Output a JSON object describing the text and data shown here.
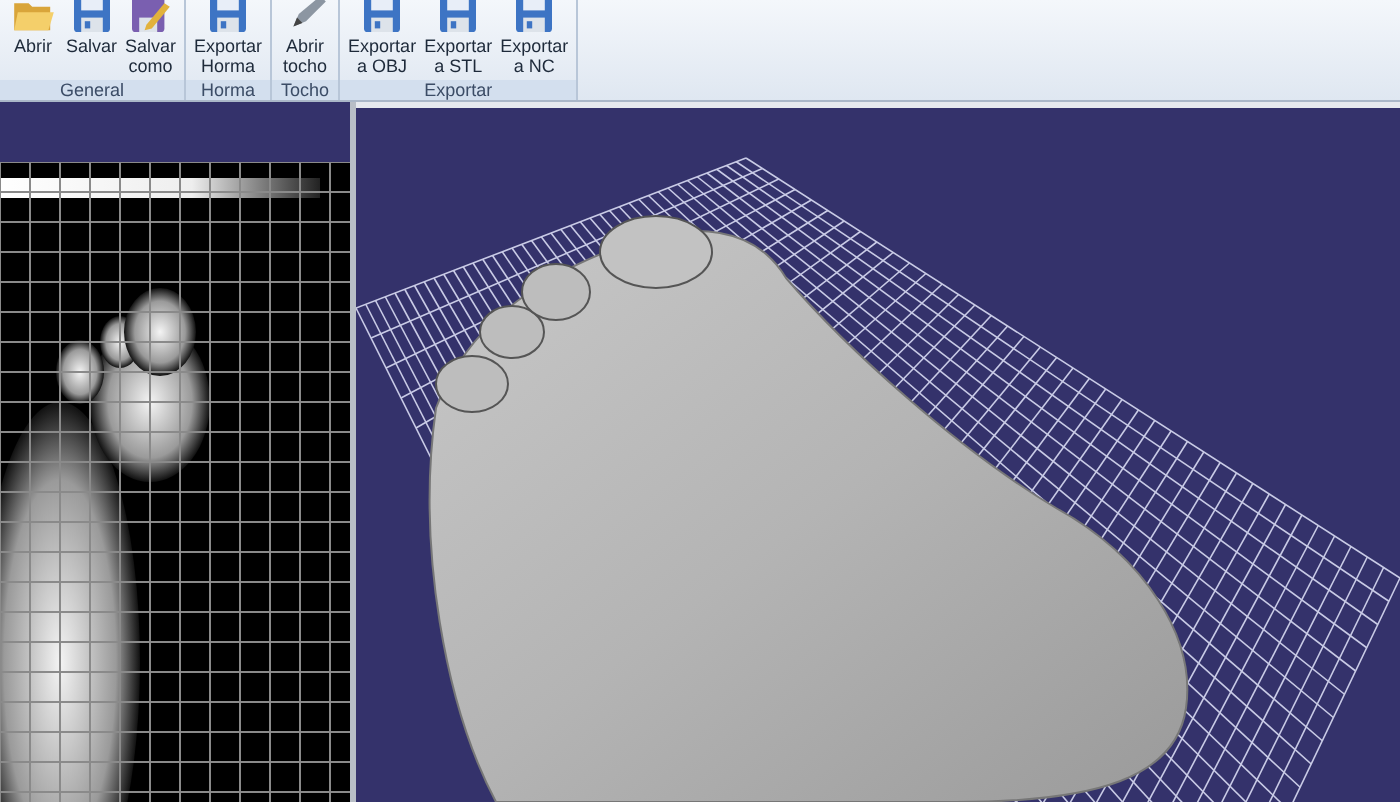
{
  "ribbon": {
    "groups": [
      {
        "label": "General",
        "buttons": [
          {
            "kind": "folder",
            "lines": [
              "Abrir"
            ]
          },
          {
            "kind": "disk",
            "lines": [
              "Salvar"
            ]
          },
          {
            "kind": "disk-pencil",
            "lines": [
              "Salvar",
              "como"
            ]
          }
        ]
      },
      {
        "label": "Horma",
        "buttons": [
          {
            "kind": "disk",
            "lines": [
              "Exportar",
              "Horma"
            ]
          }
        ]
      },
      {
        "label": "Tocho",
        "buttons": [
          {
            "kind": "pencil",
            "lines": [
              "Abrir",
              "tocho"
            ]
          }
        ]
      },
      {
        "label": "Exportar",
        "buttons": [
          {
            "kind": "disk",
            "lines": [
              "Exportar",
              "a OBJ"
            ]
          },
          {
            "kind": "disk",
            "lines": [
              "Exportar",
              "a STL"
            ]
          },
          {
            "kind": "disk",
            "lines": [
              "Exportar",
              "a NC"
            ]
          }
        ]
      }
    ]
  }
}
